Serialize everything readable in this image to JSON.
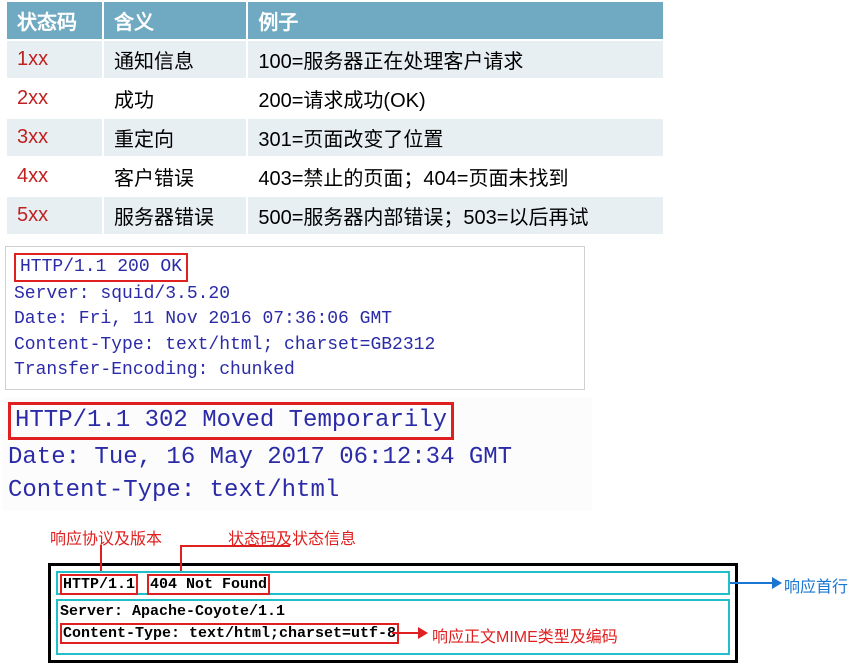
{
  "table": {
    "headers": {
      "code": "状态码",
      "meaning": "含义",
      "example": "例子"
    },
    "rows": [
      {
        "code": "1xx",
        "meaning": "通知信息",
        "example": "100=服务器正在处理客户请求"
      },
      {
        "code": "2xx",
        "meaning": "成功",
        "example": "200=请求成功(OK)"
      },
      {
        "code": "3xx",
        "meaning": "重定向",
        "example": "301=页面改变了位置"
      },
      {
        "code": "4xx",
        "meaning": "客户错误",
        "example": "403=禁止的页面；404=页面未找到"
      },
      {
        "code": "5xx",
        "meaning": "服务器错误",
        "example": "500=服务器内部错误；503=以后再试"
      }
    ]
  },
  "http200": {
    "status_line": "HTTP/1.1 200 OK",
    "headers": [
      "Server: squid/3.5.20",
      "Date: Fri, 11 Nov 2016 07:36:06 GMT",
      "Content-Type: text/html; charset=GB2312",
      "Transfer-Encoding: chunked"
    ]
  },
  "http302": {
    "status_line": "HTTP/1.1 302 Moved Temporarily",
    "headers": [
      "Date: Tue, 16 May 2017 06:12:34 GMT",
      "Content-Type: text/html"
    ]
  },
  "diagram": {
    "label_protocol": "响应协议及版本",
    "label_status": "状态码及状态信息",
    "label_firstline": "响应首行",
    "label_mime": "响应正文MIME类型及编码",
    "l1_proto": "HTTP/1.1",
    "l1_status": "404 Not Found",
    "l2": "Server: Apache-Coyote/1.1",
    "l3": "Content-Type: text/html;charset=utf-8"
  }
}
